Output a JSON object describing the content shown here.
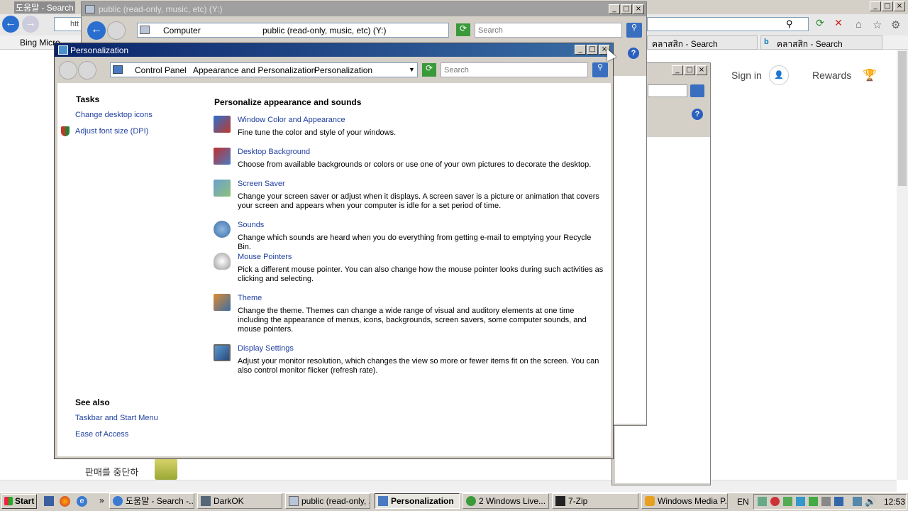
{
  "browser": {
    "tab_title": "도움말 - Search",
    "address": "htt",
    "fav_tab": "Bing Micro",
    "tabs": [
      "คลาสสิก - Search",
      "คลาสสิก - Search"
    ],
    "sign_in": "Sign in",
    "rewards": "Rewards",
    "korean_text": "판매를 중단하"
  },
  "explorer": {
    "title": "public (read-only, music, etc) (Y:)",
    "crumbs": [
      "Computer",
      "public (read-only, music, etc) (Y:)"
    ],
    "search_placeholder": "Search"
  },
  "window": {
    "title": "Personalization",
    "crumbs": [
      "Control Panel",
      "Appearance and Personalization",
      "Personalization"
    ],
    "search_placeholder": "Search"
  },
  "tasks": {
    "heading": "Tasks",
    "items": [
      "Change desktop icons",
      "Adjust font size (DPI)"
    ]
  },
  "see_also": {
    "heading": "See also",
    "items": [
      "Taskbar and Start Menu",
      "Ease of Access"
    ]
  },
  "main": {
    "heading": "Personalize appearance and sounds",
    "items": [
      {
        "title": "Window Color and Appearance",
        "desc": "Fine tune the color and style of your windows.",
        "icon": "window-color-icon"
      },
      {
        "title": "Desktop Background",
        "desc": "Choose from available backgrounds or colors or use one of your own pictures to decorate the desktop.",
        "icon": "desktop-background-icon"
      },
      {
        "title": "Screen Saver",
        "desc": "Change your screen saver or adjust when it displays. A screen saver is a picture or animation that covers your screen and appears when your computer is idle for a set period of time.",
        "icon": "screen-saver-icon"
      },
      {
        "title": "Sounds",
        "desc": "Change which sounds are heard when you do everything from getting e-mail to emptying your Recycle Bin.",
        "icon": "sounds-icon"
      },
      {
        "title": "Mouse Pointers",
        "desc": "Pick a different mouse pointer. You can also change how the mouse pointer looks during such activities as clicking and selecting.",
        "icon": "mouse-pointers-icon"
      },
      {
        "title": "Theme",
        "desc": "Change the theme. Themes can change a wide range of visual and auditory elements at one time including the appearance of menus, icons, backgrounds, screen savers, some computer sounds, and mouse pointers.",
        "icon": "theme-icon"
      },
      {
        "title": "Display Settings",
        "desc": "Adjust your monitor resolution, which changes the view so more or fewer items fit on the screen. You can also control monitor flicker (refresh rate).",
        "icon": "display-settings-icon"
      }
    ]
  },
  "taskbar": {
    "start": "Start",
    "items": [
      "도움말 - Search -...",
      "DarkOK",
      "public (read-only, ...",
      "Personalization",
      "2 Windows Live...",
      "7-Zip",
      "Windows Media P..."
    ],
    "lang": "EN",
    "clock": "12:53"
  }
}
